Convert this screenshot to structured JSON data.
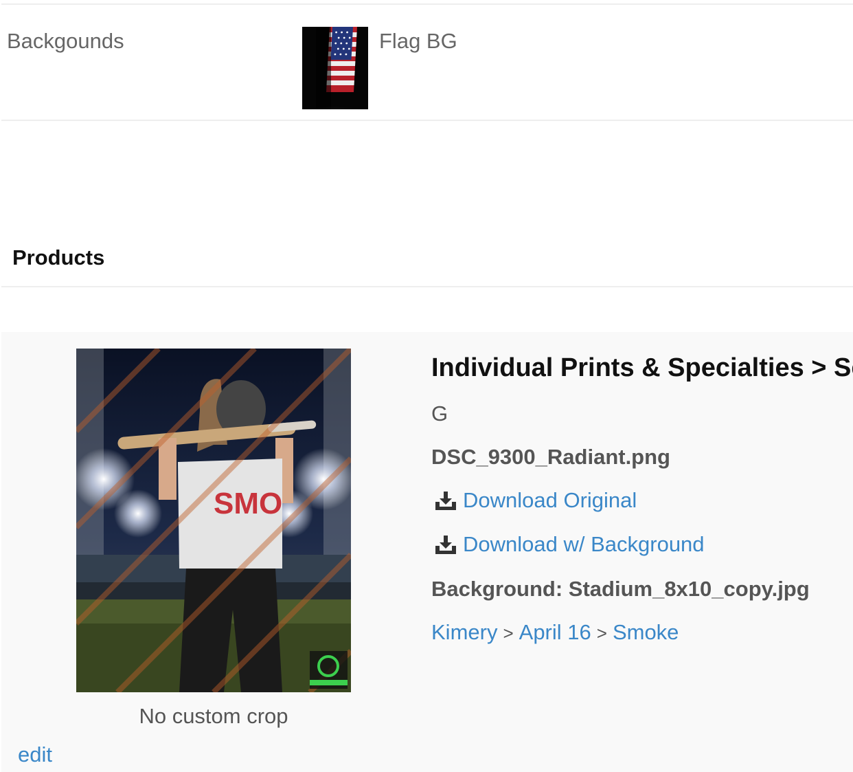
{
  "backgrounds": {
    "label": "Backgounds",
    "selected_name": "Flag BG"
  },
  "products": {
    "heading": "Products"
  },
  "product": {
    "title": "Individual Prints & Specialties > Set",
    "size": "G",
    "filename": "DSC_9300_Radiant.png",
    "download_original": "Download Original",
    "download_with_background": "Download w/ Background",
    "background": "Background: Stadium_8x10_copy.jpg",
    "crop_note": "No custom crop",
    "edit_label": "edit",
    "breadcrumb": [
      "Kimery",
      "April 16",
      "Smoke"
    ],
    "breadcrumb_separator": ">"
  },
  "colors": {
    "link": "#3a87c8",
    "text": "#555555",
    "panel_bg": "#f9f9f9"
  }
}
